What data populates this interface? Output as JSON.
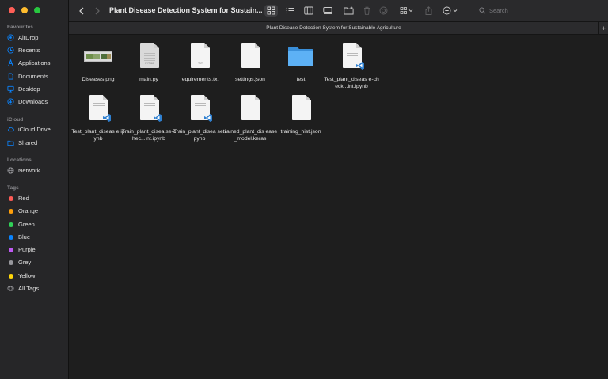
{
  "window": {
    "title": "Plant Disease Detection System for Sustain...",
    "path_title": "Plant Disease Detection System for Sustainable Agriculture",
    "plus_label": "+"
  },
  "toolbar": {
    "search_placeholder": "Search"
  },
  "sidebar": {
    "favourites_header": "Favourites",
    "favourites": [
      {
        "label": "AirDrop",
        "icon": "airdrop-icon"
      },
      {
        "label": "Recents",
        "icon": "clock-icon"
      },
      {
        "label": "Applications",
        "icon": "applications-icon"
      },
      {
        "label": "Documents",
        "icon": "document-icon"
      },
      {
        "label": "Desktop",
        "icon": "desktop-icon"
      },
      {
        "label": "Downloads",
        "icon": "download-icon"
      }
    ],
    "icloud_header": "iCloud",
    "icloud": [
      {
        "label": "iCloud Drive",
        "icon": "cloud-icon"
      },
      {
        "label": "Shared",
        "icon": "shared-folder-icon"
      }
    ],
    "locations_header": "Locations",
    "locations": [
      {
        "label": "Network",
        "icon": "globe-icon"
      }
    ],
    "tags_header": "Tags",
    "tags": [
      {
        "label": "Red",
        "color": "#ff5b56"
      },
      {
        "label": "Orange",
        "color": "#ff9f0a"
      },
      {
        "label": "Green",
        "color": "#30d158"
      },
      {
        "label": "Blue",
        "color": "#0a84ff"
      },
      {
        "label": "Purple",
        "color": "#bf5af2"
      },
      {
        "label": "Grey",
        "color": "#98989d"
      },
      {
        "label": "Yellow",
        "color": "#ffd60a"
      },
      {
        "label": "All Tags...",
        "color": ""
      }
    ]
  },
  "files": [
    {
      "name": "Diseases.png",
      "kind": "image"
    },
    {
      "name": "main.py",
      "kind": "python",
      "label": "PYTHON"
    },
    {
      "name": "requirements.txt",
      "kind": "text",
      "label": "TXT"
    },
    {
      "name": "settings.json",
      "kind": "blank"
    },
    {
      "name": "test",
      "kind": "folder"
    },
    {
      "name": "Test_plant_diseas e-check...int.ipynb",
      "kind": "notebook"
    },
    {
      "name": "Test_plant_diseas e.ipynb",
      "kind": "notebook"
    },
    {
      "name": "Train_plant_disea se-chec...int.ipynb",
      "kind": "notebook"
    },
    {
      "name": "Train_plant_disea se.ipynb",
      "kind": "notebook"
    },
    {
      "name": "trained_plant_dis ease_model.keras",
      "kind": "blank"
    },
    {
      "name": "training_hist.json",
      "kind": "blank"
    }
  ],
  "colors": {
    "accent": "#0a84ff",
    "folder": "#4aa3f0",
    "vscode": "#2f80d1"
  }
}
